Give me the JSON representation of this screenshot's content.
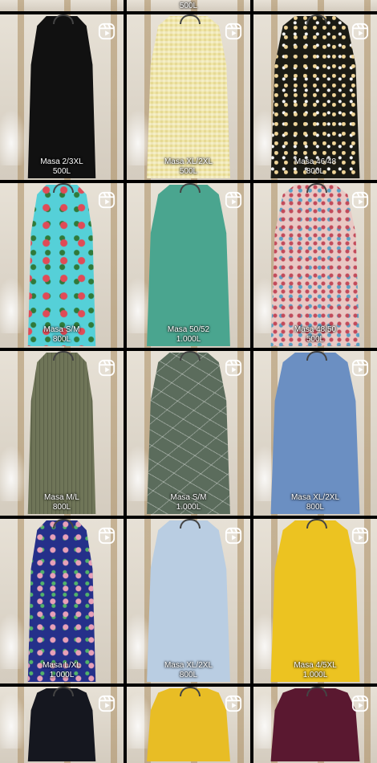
{
  "grid": {
    "top_partial_price": "500L",
    "rows": [
      [
        {
          "size": "Masa 2/3XL",
          "price": "500L",
          "color": "#111111",
          "pattern": "solid"
        },
        {
          "size": "Masa XL/2XL",
          "price": "500L",
          "color": "#f0e6a8",
          "pattern": "gingham"
        },
        {
          "size": "Masa 46/48",
          "price": "800L",
          "color": "#1b1b14",
          "pattern": "floral-dark"
        }
      ],
      [
        {
          "size": "Masa S/M",
          "price": "800L",
          "color": "#55d0d8",
          "pattern": "floral-turquoise"
        },
        {
          "size": "Masa 50/52",
          "price": "1.000L",
          "color": "#4aa58f",
          "pattern": "solid"
        },
        {
          "size": "Masa 48/50",
          "price": "500L",
          "color": "#e9c8c4",
          "pattern": "floral-light"
        }
      ],
      [
        {
          "size": "Masa M/L",
          "price": "800L",
          "color": "#6f7558",
          "pattern": "stripes"
        },
        {
          "size": "Masa S/M",
          "price": "1.000L",
          "color": "#5b6c5c",
          "pattern": "lines"
        },
        {
          "size": "Masa XL/2XL",
          "price": "800L",
          "color": "#6b8fc2",
          "pattern": "solid"
        }
      ],
      [
        {
          "size": "Masa L/XL",
          "price": "1.000L",
          "color": "#25308a",
          "pattern": "floral-blue"
        },
        {
          "size": "Masa XL/2XL",
          "price": "800L",
          "color": "#b9cde2",
          "pattern": "solid"
        },
        {
          "size": "Masa 4/5XL",
          "price": "1.000L",
          "color": "#ecc321",
          "pattern": "solid"
        }
      ],
      [
        {
          "size": "",
          "price": "",
          "color": "#15171f",
          "pattern": "solid"
        },
        {
          "size": "",
          "price": "",
          "color": "#e8bd25",
          "pattern": "solid"
        },
        {
          "size": "",
          "price": "",
          "color": "#5a1830",
          "pattern": "solid"
        }
      ]
    ]
  },
  "icons": {
    "reel": "reels-icon"
  }
}
